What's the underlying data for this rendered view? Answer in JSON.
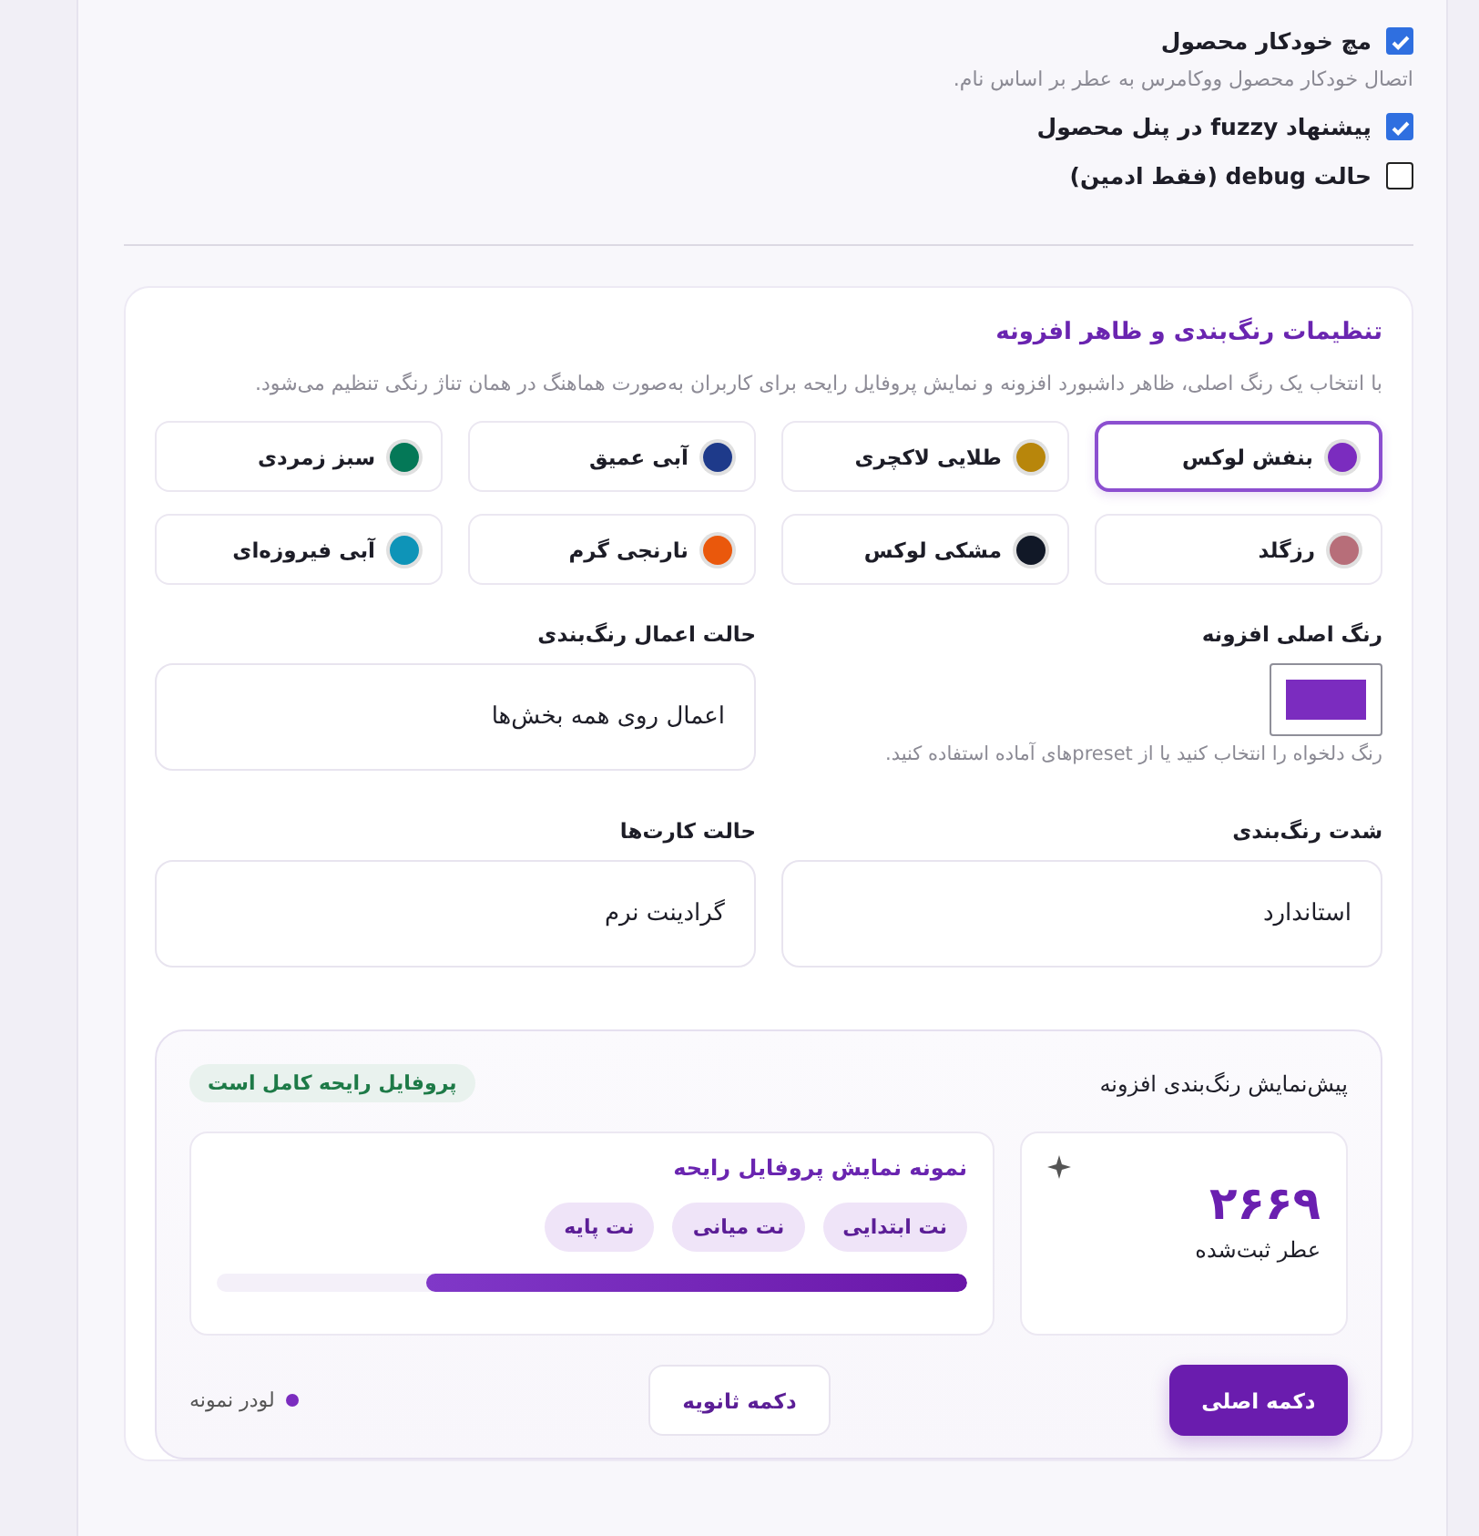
{
  "options": [
    {
      "label": "مچ خودکار محصول",
      "checked": true,
      "description": "اتصال خودکار محصول ووکامرس به عطر بر اساس نام."
    },
    {
      "label": "پیشنهاد fuzzy در پنل محصول",
      "checked": true
    },
    {
      "label": "حالت debug (فقط ادمین)",
      "checked": false
    }
  ],
  "appearance": {
    "title": "تنظیمات رنگ‌بندی و ظاهر افزونه",
    "description": "با انتخاب یک رنگ اصلی، ظاهر داشبورد افزونه و نمایش پروفایل رایحه برای کاربران به‌صورت هماهنگ در همان تناژ رنگی تنظیم می‌شود.",
    "presets": [
      {
        "label": "بنفش لوکس",
        "color": "#7b2cbf",
        "selected": true
      },
      {
        "label": "طلایی لاکچری",
        "color": "#b8860b",
        "selected": false
      },
      {
        "label": "آبی عمیق",
        "color": "#1e3a8a",
        "selected": false
      },
      {
        "label": "سبز زمردی",
        "color": "#047857",
        "selected": false
      },
      {
        "label": "رزگلد",
        "color": "#b76e79",
        "selected": false
      },
      {
        "label": "مشکی لوکس",
        "color": "#111827",
        "selected": false
      },
      {
        "label": "نارنجی گرم",
        "color": "#ea580c",
        "selected": false
      },
      {
        "label": "آبی فیروزه‌ای",
        "color": "#0e94b8",
        "selected": false
      }
    ],
    "fields": [
      {
        "kind": "color",
        "label": "رنگ اصلی افزونه",
        "color": "#7b2cbf",
        "hint": "رنگ دلخواه را انتخاب کنید یا از presetهای آماده استفاده کنید."
      },
      {
        "kind": "select",
        "label": "حالت اعمال رنگ‌بندی",
        "value": "اعمال روی همه بخش‌ها"
      },
      {
        "kind": "select",
        "label": "شدت رنگ‌بندی",
        "value": "استاندارد"
      },
      {
        "kind": "select",
        "label": "حالت کارت‌ها",
        "value": "گرادینت نرم"
      }
    ],
    "preview": {
      "title": "پیش‌نمایش رنگ‌بندی افزونه",
      "badge": "پروفایل رایحه کامل است",
      "stat": {
        "value": "۲۶۶۹",
        "label": "عطر ثبت‌شده"
      },
      "profile": {
        "title": "نمونه نمایش پروفایل رایحه",
        "notes": [
          "نت ابتدایی",
          "نت میانی",
          "نت پایه"
        ],
        "level": 0.72
      },
      "primary_button": "دکمه اصلی",
      "secondary_button": "دکمه ثانویه",
      "loader": "لودر نمونه"
    }
  }
}
